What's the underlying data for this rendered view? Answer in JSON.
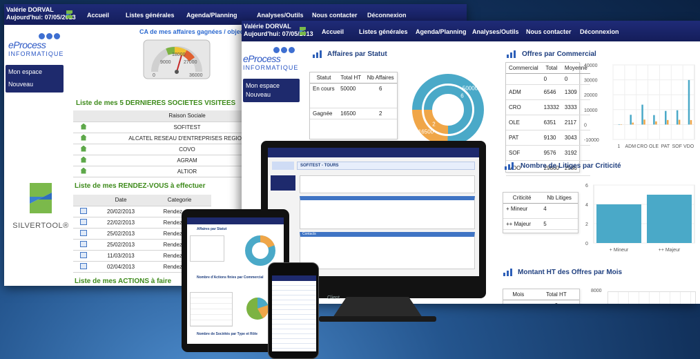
{
  "back_window": {
    "user_name": "Valérie DORVAL",
    "date_line": "Aujourd'hui: 07/05/2013",
    "nav": [
      "Accueil",
      "Listes générales",
      "Agenda/Planning",
      "Analyses/Outils",
      "Nous contacter",
      "Déconnexion"
    ],
    "brand_line1": "eProcess",
    "brand_line2": "INFORMATIQUE",
    "sidebar": [
      "Mon espace",
      "Nouveau"
    ],
    "gauge_title": "CA de mes affaires gagnées / objectif en €",
    "gauge_ticks": [
      "9000",
      "18000",
      "27000",
      "0",
      "36000"
    ],
    "visited_title": "Liste de mes 5 DERNIERES SOCIETES VISITEES",
    "visited_header": "Raison Sociale",
    "visited_rows": [
      "SOFITEST",
      "ALCATEL RESEAU D'ENTREPRISES REGION",
      "COVO",
      "AGRAM",
      "ALTIOR"
    ],
    "rdv_title": "Liste de mes RENDEZ-VOUS à effectuer",
    "rdv_header_date": "Date",
    "rdv_header_cat": "Categorie",
    "rdv_rows": [
      {
        "date": "20/02/2013",
        "cat": "Rendez-vous"
      },
      {
        "date": "22/02/2013",
        "cat": "Rendez-vous"
      },
      {
        "date": "25/02/2013",
        "cat": "Rendez-vous"
      },
      {
        "date": "25/02/2013",
        "cat": "Rendez-vous"
      },
      {
        "date": "11/03/2013",
        "cat": "Rendez-vous"
      },
      {
        "date": "02/04/2013",
        "cat": "Rendez-vous"
      }
    ],
    "actions_title": "Liste de mes ACTIONS à faire",
    "silvertool": "SILVERTOOL®"
  },
  "front_window": {
    "user_name": "Valérie DORVAL",
    "date_line": "Aujourd'hui: 07/05/2013",
    "nav": [
      "Accueil",
      "Listes générales",
      "Agenda/Planning",
      "Analyses/Outils",
      "Nous contacter",
      "Déconnexion"
    ],
    "sidebar": [
      "Mon espace",
      "Nouveau"
    ],
    "affaires": {
      "title": "Affaires par Statut",
      "headers": [
        "Statut",
        "Total HT",
        "Nb Affaires"
      ],
      "rows": [
        [
          "En cours",
          "50000",
          "6"
        ],
        [
          "Gagnée",
          "16500",
          "2"
        ]
      ]
    },
    "offres": {
      "title": "Offres par Commercial",
      "headers": [
        "Commercial",
        "Total",
        "Moyenne"
      ],
      "rows": [
        [
          "",
          "0",
          "0"
        ],
        [
          "ADM",
          "6546",
          "1309"
        ],
        [
          "CRO",
          "13332",
          "3333"
        ],
        [
          "OLE",
          "6351",
          "2117"
        ],
        [
          "PAT",
          "9130",
          "3043"
        ],
        [
          "SOF",
          "9576",
          "3192"
        ],
        [
          "VDO",
          "29860",
          "2986"
        ]
      ]
    },
    "litiges": {
      "title": "Nombre de Litiges par Criticité",
      "headers": [
        "Criticité",
        "Nb Litiges"
      ],
      "rows": [
        [
          "+ Mineur",
          "4"
        ],
        [
          "++ Majeur",
          "5"
        ]
      ]
    },
    "montant": {
      "title": "Montant HT des Offres par Mois",
      "headers": [
        "Mois",
        "Total HT"
      ],
      "rows": [
        [
          "",
          "0"
        ]
      ],
      "axis_top": "8000"
    }
  },
  "chart_data": [
    {
      "type": "pie",
      "title": "Affaires par Statut",
      "categories": [
        "En cours",
        "Gagnée"
      ],
      "series": [
        {
          "name": "Nb Affaires",
          "values": [
            6,
            2
          ]
        },
        {
          "name": "Total HT",
          "values": [
            50000,
            16500
          ]
        }
      ],
      "colors": [
        "#4aa9c8",
        "#f0a648"
      ]
    },
    {
      "type": "bar",
      "title": "Offres par Commercial",
      "categories": [
        "1",
        "ADM",
        "CRO",
        "OLE",
        "PAT",
        "SOF",
        "VDO"
      ],
      "series": [
        {
          "name": "Total",
          "values": [
            0,
            6546,
            13332,
            6351,
            9130,
            9576,
            29860
          ]
        },
        {
          "name": "Moyenne",
          "values": [
            0,
            1309,
            3333,
            2117,
            3043,
            3192,
            2986
          ]
        }
      ],
      "yticks": [
        "40000",
        "30000",
        "20000",
        "10000",
        "0",
        "-10000"
      ],
      "ylim": [
        -10000,
        40000
      ],
      "colors": [
        "#4aa9c8",
        "#f0a648"
      ]
    },
    {
      "type": "bar",
      "title": "Nombre de Litiges par Criticité",
      "categories": [
        "+ Mineur",
        "++ Majeur"
      ],
      "values": [
        4,
        5
      ],
      "yticks": [
        "6",
        "4",
        "2",
        "0"
      ],
      "ylim": [
        0,
        6
      ],
      "colors": [
        "#4aa9c8"
      ]
    }
  ],
  "devices": {
    "monitor_screen_title": "SOFITEST - TOURS",
    "monitor_tab_contacts": "Contacts",
    "monitor_client": "Client",
    "tablet_header": "Affaires par Statut",
    "tablet_section": "Nombre d'Actions finies par Commercial",
    "tablet_footer": "Nombre de Sociétés par Type et Rôle"
  }
}
